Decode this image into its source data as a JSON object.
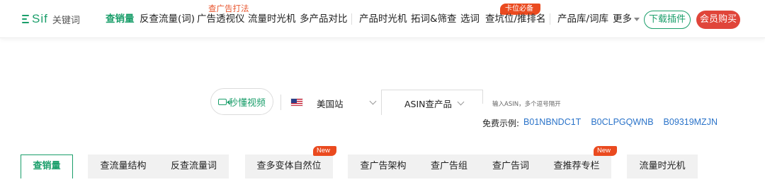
{
  "brand": {
    "name": "Sif",
    "sub": "关键词"
  },
  "nav": {
    "items": [
      {
        "label": "查销量",
        "active": true
      },
      {
        "label": "反查流量(词)"
      },
      {
        "label": "广告透视仪",
        "over_label": "查广告打法"
      },
      {
        "label": "流量时光机"
      },
      {
        "label": "多产品对比"
      },
      {
        "label": "产品时光机"
      },
      {
        "label": "拓词&筛查"
      },
      {
        "label": "选词"
      },
      {
        "label": "查坑位/推排名",
        "badge": "卡位必备"
      },
      {
        "label": "产品库/词库"
      },
      {
        "label": "更多"
      }
    ],
    "download_label": "下载插件",
    "member_label": "会员购买"
  },
  "search": {
    "video_label": "秒懂视频",
    "site": "美国站",
    "mode": "ASIN查产品",
    "hint": "输入ASIN，多个逗号隔开",
    "examples_label": "免费示例:",
    "examples": [
      "B01NBNDC1T",
      "B0CLPGQWNB",
      "B09319MZJN"
    ]
  },
  "tabs": [
    {
      "label": "查销量",
      "active": true
    },
    {
      "label": "查流量结构"
    },
    {
      "label": "反查流量词"
    },
    {
      "label": "查多变体自然位",
      "badge": "New"
    },
    {
      "label": "查广告架构"
    },
    {
      "label": "查广告组"
    },
    {
      "label": "查广告词"
    },
    {
      "label": "查推荐专栏",
      "badge": "New"
    },
    {
      "label": "流量时光机"
    }
  ],
  "colors": {
    "brand_green": "#1a9e6a",
    "member_red": "#e0453a",
    "link_blue": "#2a73c9",
    "badge_orange": "#ea4a1f"
  }
}
